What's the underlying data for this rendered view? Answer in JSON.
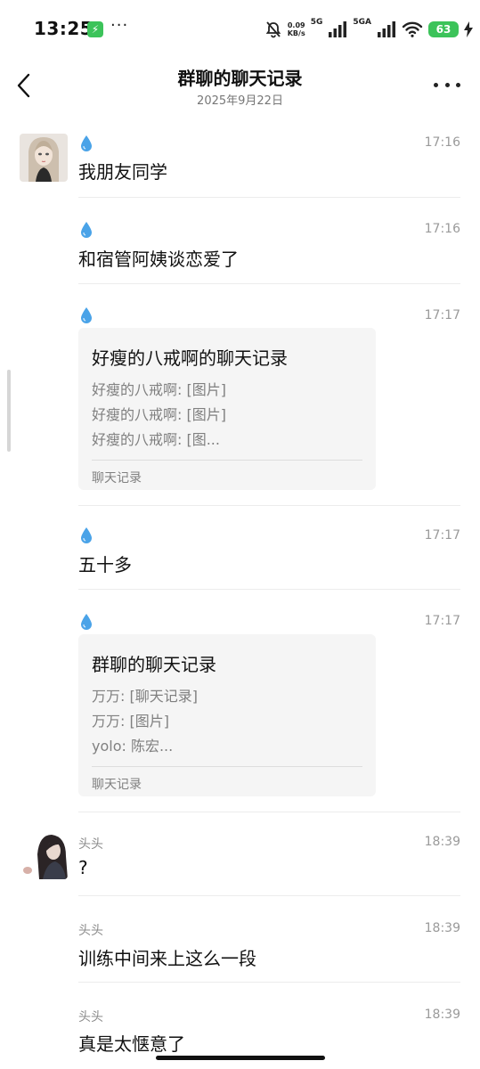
{
  "status_bar": {
    "time": "13:25",
    "app_icon": "⚡",
    "dots": "···",
    "speed_value": "0.09",
    "speed_unit": "KB/s",
    "net1": "5G",
    "net2": "5GA",
    "battery": "63",
    "icons": [
      "mute-bell-icon",
      "signal-icon",
      "wifi-icon",
      "charging-icon"
    ]
  },
  "header": {
    "title": "群聊的聊天记录",
    "subtitle": "2025年9月22日"
  },
  "messages": [
    {
      "sender": "",
      "time": "17:16",
      "text": "我朋友同学"
    },
    {
      "sender": "",
      "time": "17:16",
      "text": "和宿管阿姨谈恋爱了"
    },
    {
      "sender": "",
      "time": "17:17",
      "card": {
        "title": "好瘦的八戒啊的聊天记录",
        "lines": [
          "好瘦的八戒啊: [图片]",
          "好瘦的八戒啊: [图片]",
          "好瘦的八戒啊: [图..."
        ],
        "footer": "聊天记录"
      }
    },
    {
      "sender": "",
      "time": "17:17",
      "text": "五十多"
    },
    {
      "sender": "",
      "time": "17:17",
      "card": {
        "title": "群聊的聊天记录",
        "lines": [
          "万万: [聊天记录]",
          "万万: [图片]",
          "yolo: 陈宏..."
        ],
        "footer": "聊天记录"
      }
    },
    {
      "sender": "头头",
      "time": "18:39",
      "text": "?"
    },
    {
      "sender": "头头",
      "time": "18:39",
      "text": "训练中间来上这么一段"
    },
    {
      "sender": "头头",
      "time": "18:39",
      "text": "真是太惬意了"
    }
  ],
  "colors": {
    "accent_green": "#3cc35a",
    "drop_blue": "#4aa3e8"
  }
}
